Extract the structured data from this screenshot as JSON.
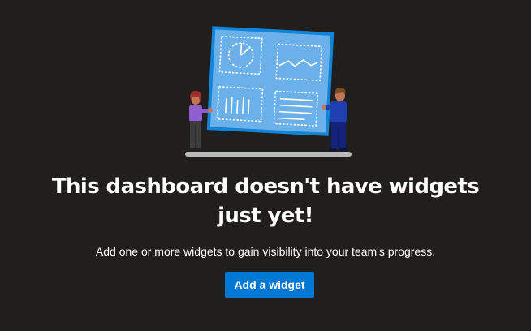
{
  "empty_state": {
    "title_line_1": "This dashboard doesn't have widgets",
    "title_line_2": "just yet!",
    "subtitle": "Add one or more widgets to gain visibility into your team's progress.",
    "add_widget_label": "Add a widget",
    "illustration_icon": "dashboard-board-with-people-illustration"
  },
  "colors": {
    "background": "#201f1e",
    "button": "#0078d4",
    "board_fill": "#69aee8",
    "board_border": "#1183d6"
  }
}
